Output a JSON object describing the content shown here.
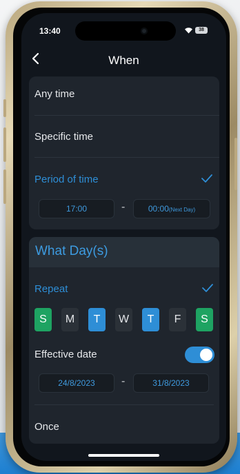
{
  "status": {
    "time": "13:40",
    "battery": "38"
  },
  "nav": {
    "title": "When"
  },
  "time_options": {
    "any_time": "Any time",
    "specific_time": "Specific time",
    "period_of_time": "Period of time",
    "period_start": "17:00",
    "period_end": "00:00",
    "period_end_note": "(Next Day)",
    "separator": "-"
  },
  "days_section": {
    "title": "What Day(s)",
    "repeat": "Repeat",
    "days": [
      "S",
      "M",
      "T",
      "W",
      "T",
      "F",
      "S"
    ],
    "effective_date": "Effective date",
    "effective_toggle_on": true,
    "date_start": "24/8/2023",
    "date_end": "31/8/2023",
    "separator": "-",
    "once": "Once"
  },
  "colors": {
    "accent": "#2e8ed6",
    "weekend": "#1ea362",
    "screen_bg": "#11161d",
    "card_bg": "#1f252d"
  }
}
